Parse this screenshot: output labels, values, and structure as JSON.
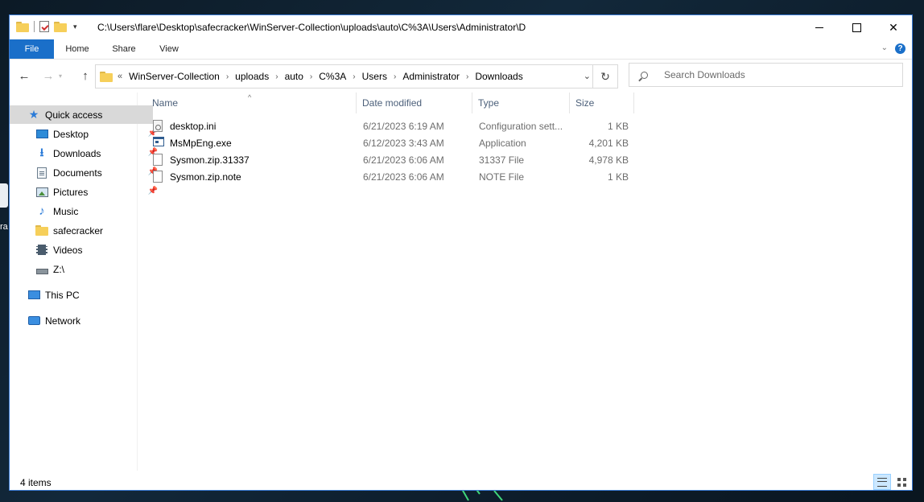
{
  "desktop": {
    "label_fragment": "ra"
  },
  "window": {
    "path_title": "C:\\Users\\flare\\Desktop\\safecracker\\WinServer-Collection\\uploads\\auto\\C%3A\\Users\\Administrator\\D",
    "accent_color": "#1a6fc9"
  },
  "ribbon": {
    "tabs": [
      {
        "label": "File"
      },
      {
        "label": "Home"
      },
      {
        "label": "Share"
      },
      {
        "label": "View"
      }
    ]
  },
  "address": {
    "overflow": "«",
    "crumbs": [
      "WinServer-Collection",
      "uploads",
      "auto",
      "C%3A",
      "Users",
      "Administrator",
      "Downloads"
    ]
  },
  "search": {
    "placeholder": "Search Downloads"
  },
  "navpane": {
    "quick_access": "Quick access",
    "quick_items": [
      {
        "label": "Desktop",
        "icon": "desktop-icon",
        "pinned": true
      },
      {
        "label": "Downloads",
        "icon": "download-arrow-icon",
        "pinned": true
      },
      {
        "label": "Documents",
        "icon": "documents-icon",
        "pinned": true
      },
      {
        "label": "Pictures",
        "icon": "pictures-icon",
        "pinned": true
      },
      {
        "label": "Music",
        "icon": "music-note-icon",
        "pinned": false
      },
      {
        "label": "safecracker",
        "icon": "folder-icon",
        "pinned": false
      },
      {
        "label": "Videos",
        "icon": "videos-icon",
        "pinned": false
      },
      {
        "label": "Z:\\",
        "icon": "network-drive-icon",
        "pinned": false
      }
    ],
    "this_pc": "This PC",
    "network": "Network"
  },
  "filelist": {
    "columns": {
      "name": "Name",
      "date": "Date modified",
      "type": "Type",
      "size": "Size"
    },
    "rows": [
      {
        "name": "desktop.ini",
        "date": "6/21/2023 6:19 AM",
        "type": "Configuration sett...",
        "size": "1 KB",
        "icon": "config-file-icon"
      },
      {
        "name": "MsMpEng.exe",
        "date": "6/12/2023 3:43 AM",
        "type": "Application",
        "size": "4,201 KB",
        "icon": "application-icon"
      },
      {
        "name": "Sysmon.zip.31337",
        "date": "6/21/2023 6:06 AM",
        "type": "31337 File",
        "size": "4,978 KB",
        "icon": "blank-file-icon"
      },
      {
        "name": "Sysmon.zip.note",
        "date": "6/21/2023 6:06 AM",
        "type": "NOTE File",
        "size": "1 KB",
        "icon": "blank-file-icon"
      }
    ]
  },
  "status": {
    "item_count": "4 items"
  }
}
